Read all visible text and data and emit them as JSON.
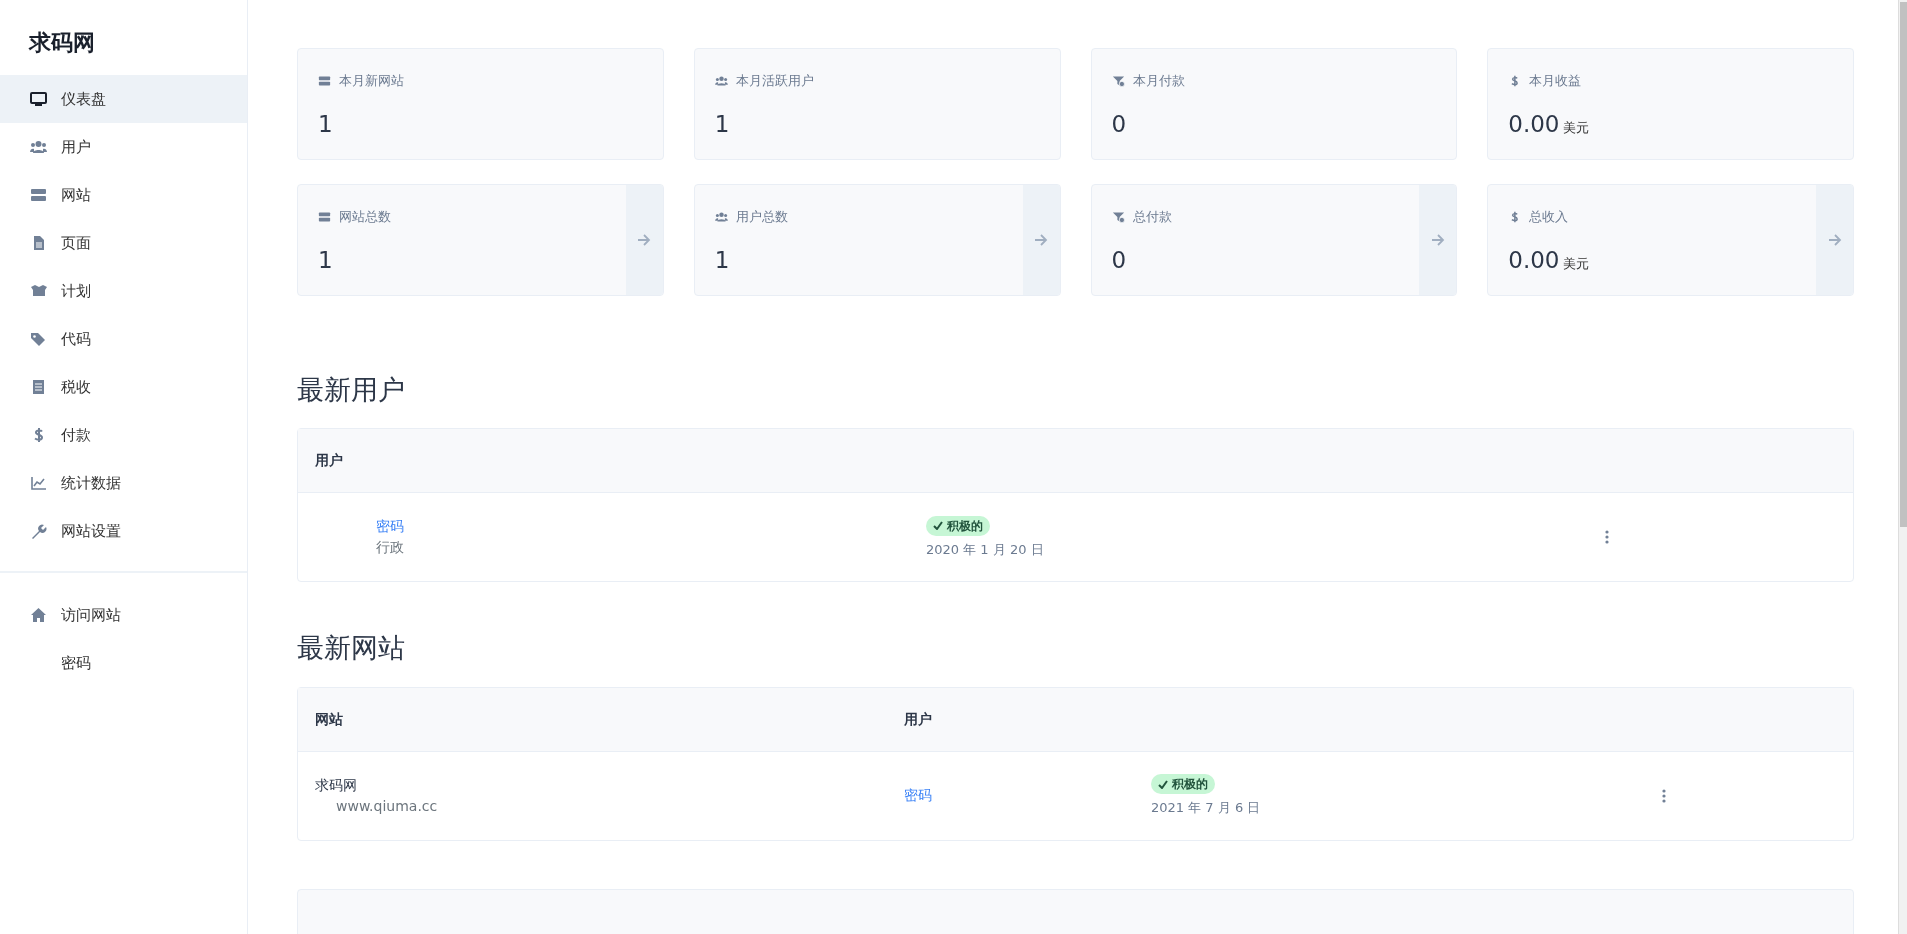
{
  "sidebar": {
    "brand": "求码网",
    "items": [
      {
        "label": "仪表盘",
        "selected": true
      },
      {
        "label": "用户",
        "selected": false
      },
      {
        "label": "网站",
        "selected": false
      },
      {
        "label": "页面",
        "selected": false
      },
      {
        "label": "计划",
        "selected": false
      },
      {
        "label": "代码",
        "selected": false
      },
      {
        "label": "税收",
        "selected": false
      },
      {
        "label": "付款",
        "selected": false
      },
      {
        "label": "统计数据",
        "selected": false
      },
      {
        "label": "网站设置",
        "selected": false
      }
    ],
    "footer_items": [
      {
        "label": "访问网站"
      },
      {
        "label": "密码"
      }
    ]
  },
  "stat_rows": [
    [
      {
        "kind": "plain",
        "label": "本月新网站",
        "value": "1"
      },
      {
        "kind": "plain",
        "label": "本月活跃用户",
        "value": "1"
      },
      {
        "kind": "plain",
        "label": "本月付款",
        "value": "0"
      },
      {
        "kind": "plain",
        "label": "本月收益",
        "value": "0.00",
        "unit": "美元"
      }
    ],
    [
      {
        "kind": "link",
        "label": "网站总数",
        "value": "1"
      },
      {
        "kind": "link",
        "label": "用户总数",
        "value": "1"
      },
      {
        "kind": "link",
        "label": "总付款",
        "value": "0"
      },
      {
        "kind": "link",
        "label": "总收入",
        "value": "0.00",
        "unit": "美元"
      }
    ]
  ],
  "latest_users": {
    "title": "最新用户",
    "columns": [
      "用户"
    ],
    "rows": [
      {
        "name": "密码",
        "role": "行政",
        "status": "积极的",
        "date": "2020 年 1 月 20 日"
      }
    ]
  },
  "latest_sites": {
    "title": "最新网站",
    "columns": [
      "网站",
      "用户"
    ],
    "rows": [
      {
        "name": "求码网",
        "url": "www.qiuma.cc",
        "user": "密码",
        "status": "积极的",
        "date": "2021 年 7 月 6 日"
      }
    ]
  }
}
